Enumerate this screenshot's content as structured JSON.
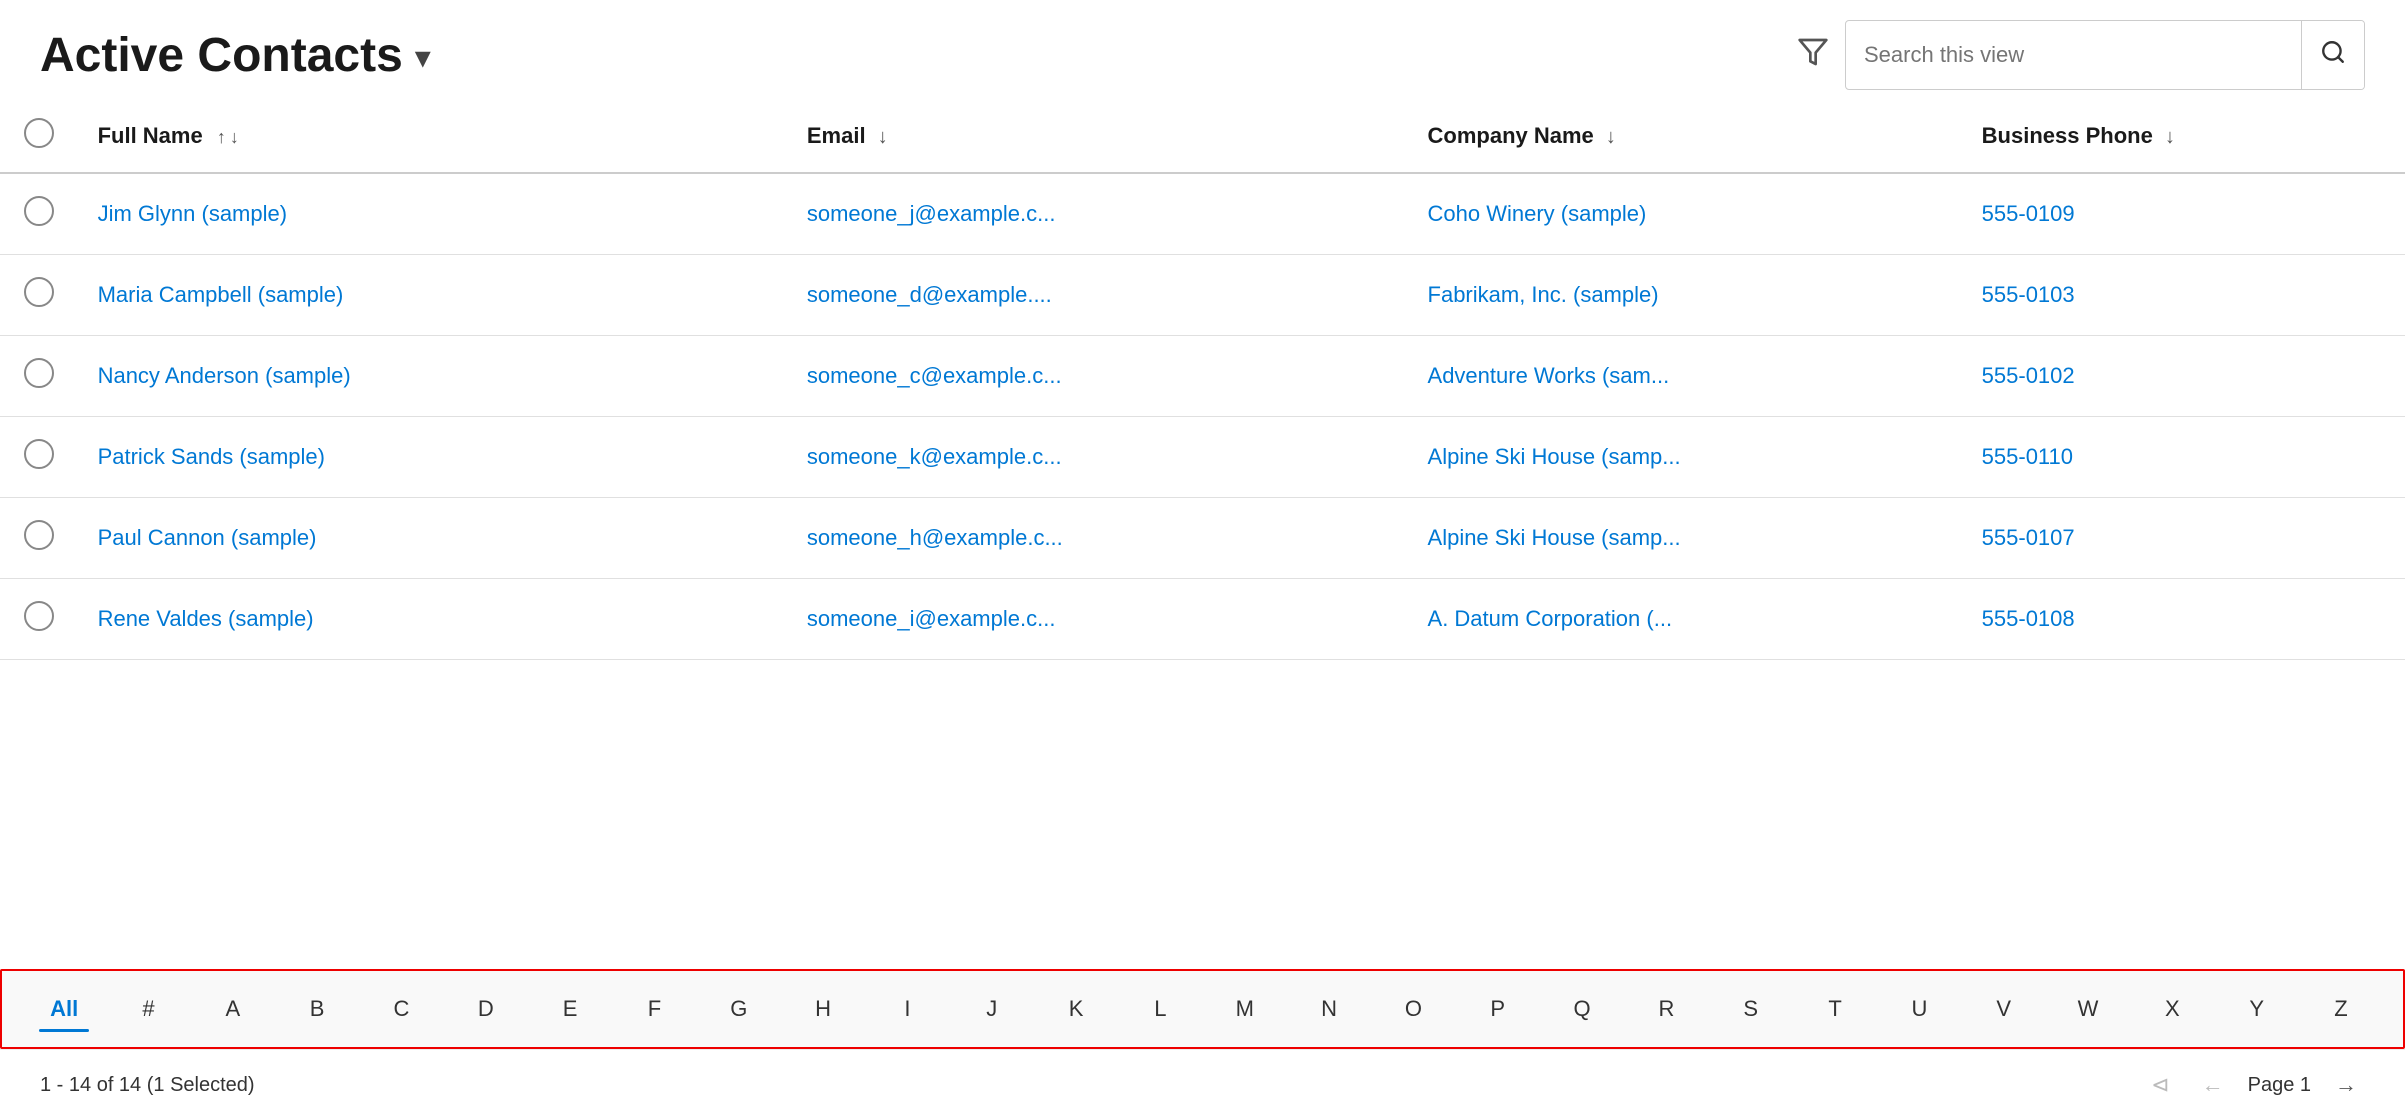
{
  "header": {
    "title": "Active Contacts",
    "chevron": "▾",
    "filter_icon": "⊽",
    "search_placeholder": "Search this view",
    "search_icon": "🔍"
  },
  "table": {
    "columns": [
      {
        "key": "checkbox",
        "label": ""
      },
      {
        "key": "fullname",
        "label": "Full Name"
      },
      {
        "key": "email",
        "label": "Email"
      },
      {
        "key": "company",
        "label": "Company Name"
      },
      {
        "key": "phone",
        "label": "Business Phone"
      }
    ],
    "rows": [
      {
        "fullname": "Jim Glynn (sample)",
        "email": "someone_j@example.c...",
        "company": "Coho Winery (sample)",
        "phone": "555-0109"
      },
      {
        "fullname": "Maria Campbell (sample)",
        "email": "someone_d@example....",
        "company": "Fabrikam, Inc. (sample)",
        "phone": "555-0103"
      },
      {
        "fullname": "Nancy Anderson (sample)",
        "email": "someone_c@example.c...",
        "company": "Adventure Works (sam...",
        "phone": "555-0102"
      },
      {
        "fullname": "Patrick Sands (sample)",
        "email": "someone_k@example.c...",
        "company": "Alpine Ski House (samp...",
        "phone": "555-0110"
      },
      {
        "fullname": "Paul Cannon (sample)",
        "email": "someone_h@example.c...",
        "company": "Alpine Ski House (samp...",
        "phone": "555-0107"
      },
      {
        "fullname": "Rene Valdes (sample)",
        "email": "someone_i@example.c...",
        "company": "A. Datum Corporation (...",
        "phone": "555-0108"
      }
    ]
  },
  "alpha_bar": {
    "items": [
      "All",
      "#",
      "A",
      "B",
      "C",
      "D",
      "E",
      "F",
      "G",
      "H",
      "I",
      "J",
      "K",
      "L",
      "M",
      "N",
      "O",
      "P",
      "Q",
      "R",
      "S",
      "T",
      "U",
      "V",
      "W",
      "X",
      "Y",
      "Z"
    ],
    "active": "All"
  },
  "footer": {
    "info": "1 - 14 of 14 (1 Selected)",
    "page_label": "Page 1"
  }
}
